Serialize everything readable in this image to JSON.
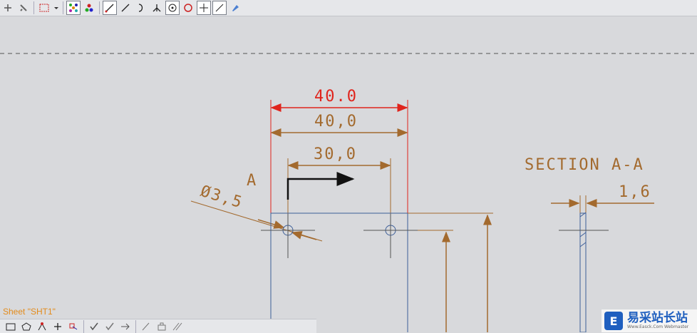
{
  "colors": {
    "dimension": "#a36a2e",
    "selected": "#e0241c",
    "part": "#3d5f99",
    "background": "#d8d9dc"
  },
  "toolbar_top": {
    "icons": [
      "view-icon",
      "pan-icon",
      "select-box-icon",
      "dropdown-icon",
      "snap-grid-icon",
      "snap-points-icon",
      "line-icon",
      "slanted-line-icon",
      "curve-icon",
      "branch-icon",
      "circle-center-icon",
      "circle-icon",
      "cross-icon",
      "angle-line-icon",
      "pin-icon"
    ]
  },
  "drawing": {
    "dim_top_selected": "40.0",
    "dim_top": "40,0",
    "dim_middle": "30,0",
    "diameter": "Ø3,5",
    "section_letter": "A",
    "section_title": "SECTION A-A",
    "dim_thickness": "1,6"
  },
  "sheet": {
    "label": "Sheet \"SHT1\""
  },
  "watermark": {
    "text": "易采站长站",
    "sub": "Www.Easck.Com Webmaster",
    "logo": "E"
  },
  "toolbar_bottom": {
    "icons": [
      "rectangle-icon",
      "polygon-icon",
      "vertex-icon",
      "plus-icon",
      "move-icon",
      "check-icon",
      "check-alt-icon",
      "arrow-icon",
      "slash-icon",
      "stamp-icon",
      "double-slash-icon"
    ]
  }
}
